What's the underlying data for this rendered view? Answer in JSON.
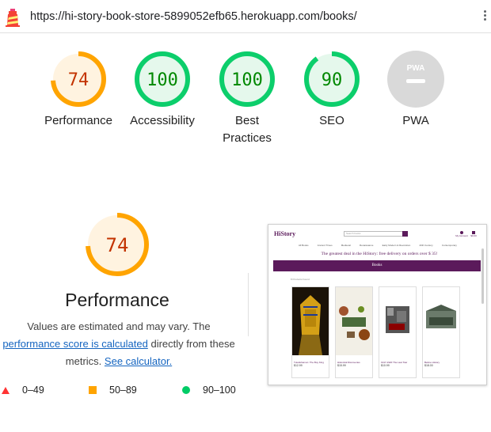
{
  "browser": {
    "url": "https://hi-story-book-store-5899052efb65.herokuapp.com/books/"
  },
  "gauges": [
    {
      "name": "performance",
      "score": "74",
      "label": "Performance",
      "level": 0.74,
      "color": "#ffa400",
      "fill": "#fff3e0",
      "text_color": "#c33300"
    },
    {
      "name": "accessibility",
      "score": "100",
      "label": "Accessibility",
      "level": 1.0,
      "color": "#0cce6b",
      "fill": "#e5f8ec",
      "text_color": "#008800"
    },
    {
      "name": "best-practices",
      "score": "100",
      "label": "Best Practices",
      "level": 1.0,
      "color": "#0cce6b",
      "fill": "#e5f8ec",
      "text_color": "#008800"
    },
    {
      "name": "seo",
      "score": "90",
      "label": "SEO",
      "level": 0.9,
      "color": "#0cce6b",
      "fill": "#e5f8ec",
      "text_color": "#008800"
    },
    {
      "name": "pwa",
      "score": "",
      "label": "PWA",
      "badge": "PWA",
      "color": "#d3d3d3",
      "fill": "#d3d3d3"
    }
  ],
  "performance": {
    "score": "74",
    "title": "Performance",
    "note_line1": "Values are estimated and may vary. The",
    "note_link1": "performance score is calculated",
    "note_mid": "directly from these",
    "note_line3_prefix": "metrics.",
    "note_link2": "See calculator."
  },
  "legend": [
    {
      "shape": "triangle",
      "label": "0–49",
      "color": "#ff3333"
    },
    {
      "shape": "square",
      "label": "50–89",
      "color": "#ffa400"
    },
    {
      "shape": "circle",
      "label": "90–100",
      "color": "#00cc66"
    }
  ],
  "thumbnail": {
    "logo": "HiStory",
    "search_placeholder": "Search books",
    "nav": [
      "All Books",
      "Ancient Times",
      "Medieval",
      "Renaissance",
      "Early Modern & Revolution",
      "20th Century",
      "Contemporary",
      "20th Century",
      "Early 20th Century"
    ],
    "banner": "The greatest deal in the HiStory: free delivery on orders over $ 35!",
    "section": "Books",
    "subline": "8 Products Found",
    "user_label": "My Account",
    "cart_label": "$0.00",
    "cards": [
      {
        "title": "Tutankhamun: The Boy King",
        "price": "$12.99"
      },
      {
        "title": "Historical Discoveries",
        "price": "$15.99"
      },
      {
        "title": "1917-1920 The Last Tsar",
        "price": "$10.99"
      },
      {
        "title": "Before History",
        "price": "$18.00"
      }
    ]
  }
}
